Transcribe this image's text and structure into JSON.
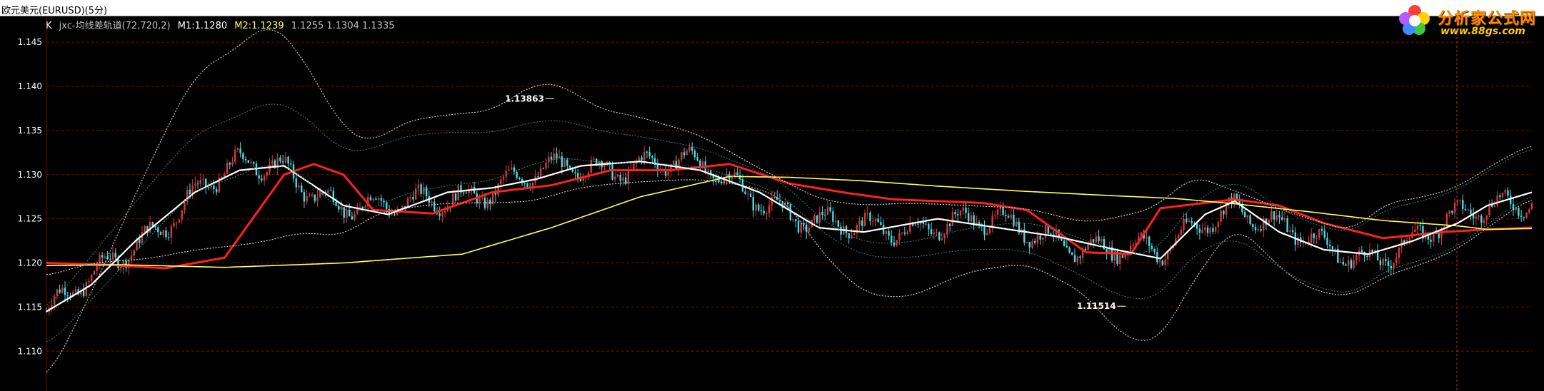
{
  "window": {
    "title": "欧元美元(EURUSD)(5分)"
  },
  "legend": {
    "k": "K",
    "indicator": "jxc-均线差轨道(72,720,2)",
    "m1": "M1:1.1280",
    "m2": "M2:1.1239",
    "extra": "1.1255 1.1304 1.1335"
  },
  "watermark": {
    "brand": "分析家公式网",
    "url": "www.88gs.com"
  },
  "colors": {
    "background": "#000000",
    "grid": "#8b0000",
    "up_candle": "#d23c3c",
    "down_candle": "#40e0e8",
    "m1": "#ffffff",
    "m2": "#ffff5a",
    "red_ma": "#ff2020",
    "band_outer": "#c8c8c8",
    "band_inner": "#2e8b7a"
  },
  "chart_data": {
    "type": "line",
    "title": "欧元美元(EURUSD)(5分)",
    "ylim": [
      1.1055,
      1.148
    ],
    "yticks": [
      "1.145",
      "1.140",
      "1.135",
      "1.130",
      "1.125",
      "1.120",
      "1.115",
      "1.110"
    ],
    "grid": "horizontal dashed",
    "annotations": [
      {
        "text": "1.13863",
        "x": 0.335,
        "y": 1.1386
      },
      {
        "text": "1.11514",
        "x": 0.72,
        "y": 1.1151
      }
    ],
    "series": [
      {
        "name": "M1",
        "color": "#ffffff",
        "x": [
          0,
          0.03,
          0.06,
          0.1,
          0.13,
          0.16,
          0.2,
          0.23,
          0.27,
          0.3,
          0.33,
          0.36,
          0.4,
          0.44,
          0.48,
          0.52,
          0.55,
          0.6,
          0.64,
          0.68,
          0.72,
          0.75,
          0.78,
          0.8,
          0.83,
          0.86,
          0.89,
          0.92,
          0.95,
          0.97,
          1.0
        ],
        "values": [
          1.1145,
          1.1175,
          1.1225,
          1.128,
          1.1305,
          1.131,
          1.1265,
          1.1255,
          1.128,
          1.1285,
          1.1295,
          1.131,
          1.1315,
          1.1305,
          1.128,
          1.124,
          1.1235,
          1.125,
          1.124,
          1.123,
          1.1215,
          1.1205,
          1.1255,
          1.127,
          1.1235,
          1.1215,
          1.121,
          1.1225,
          1.1245,
          1.1265,
          1.128
        ]
      },
      {
        "name": "M2",
        "color": "#ffff5a",
        "x": [
          0,
          0.05,
          0.12,
          0.2,
          0.28,
          0.34,
          0.4,
          0.46,
          0.5,
          0.55,
          0.6,
          0.66,
          0.72,
          0.76,
          0.8,
          0.85,
          0.9,
          0.95,
          0.97,
          1.0
        ],
        "values": [
          1.1197,
          1.1198,
          1.1195,
          1.12,
          1.121,
          1.124,
          1.1275,
          1.1298,
          1.1297,
          1.1293,
          1.1287,
          1.1281,
          1.1276,
          1.1273,
          1.1267,
          1.1258,
          1.1248,
          1.1242,
          1.1238,
          1.1239
        ]
      },
      {
        "name": "",
        "color": "#ff2020",
        "x": [
          0,
          0.04,
          0.08,
          0.12,
          0.16,
          0.18,
          0.2,
          0.22,
          0.26,
          0.3,
          0.34,
          0.38,
          0.42,
          0.46,
          0.5,
          0.54,
          0.57,
          0.6,
          0.63,
          0.66,
          0.7,
          0.73,
          0.75,
          0.8,
          0.83,
          0.86,
          0.9,
          0.94,
          0.97,
          1.0
        ],
        "values": [
          1.12,
          1.1198,
          1.1194,
          1.1206,
          1.13,
          1.1312,
          1.13,
          1.126,
          1.1256,
          1.128,
          1.1288,
          1.1305,
          1.1305,
          1.1312,
          1.129,
          1.1279,
          1.1272,
          1.127,
          1.1268,
          1.126,
          1.1212,
          1.121,
          1.1262,
          1.1272,
          1.1265,
          1.1245,
          1.1228,
          1.1235,
          1.1238,
          1.124
        ]
      },
      {
        "name": "",
        "color": "#c8c8c8",
        "x": [
          0,
          0.03,
          0.07,
          0.1,
          0.13,
          0.15,
          0.17,
          0.2,
          0.22,
          0.24,
          0.27,
          0.3,
          0.33,
          0.35,
          0.37,
          0.4,
          0.44,
          0.48,
          0.5,
          0.52,
          0.55,
          0.58,
          0.62,
          0.66,
          0.7,
          0.73,
          0.75,
          0.77,
          0.8,
          0.84,
          0.88,
          0.9,
          0.92,
          0.95,
          0.97,
          1.0
        ],
        "values": [
          1.1065,
          1.1165,
          1.1315,
          1.1415,
          1.1445,
          1.1475,
          1.144,
          1.135,
          1.1335,
          1.136,
          1.1368,
          1.1372,
          1.1405,
          1.14,
          1.1375,
          1.1365,
          1.1345,
          1.1307,
          1.129,
          1.1272,
          1.1265,
          1.1268,
          1.1265,
          1.1262,
          1.1245,
          1.1255,
          1.1265,
          1.13,
          1.1282,
          1.1255,
          1.1235,
          1.1268,
          1.1272,
          1.1285,
          1.1308,
          1.1335
        ]
      },
      {
        "name": "",
        "color": "#c8c8c8",
        "x": [
          0,
          0.03,
          0.07,
          0.1,
          0.13,
          0.15,
          0.17,
          0.2,
          0.22,
          0.24,
          0.27,
          0.3,
          0.33,
          0.35,
          0.37,
          0.4,
          0.44,
          0.48,
          0.5,
          0.52,
          0.55,
          0.58,
          0.62,
          0.66,
          0.7,
          0.72,
          0.74,
          0.75,
          0.77,
          0.8,
          0.84,
          0.86,
          0.88,
          0.9,
          0.92,
          0.95,
          0.97,
          1.0
        ],
        "values": [
          1.1185,
          1.12,
          1.1205,
          1.1215,
          1.122,
          1.1225,
          1.1235,
          1.123,
          1.1255,
          1.1262,
          1.1268,
          1.1268,
          1.127,
          1.1282,
          1.1288,
          1.1292,
          1.1295,
          1.1285,
          1.1268,
          1.1215,
          1.1165,
          1.116,
          1.119,
          1.12,
          1.1165,
          1.1122,
          1.1108,
          1.1112,
          1.1175,
          1.1245,
          1.118,
          1.1165,
          1.1162,
          1.1185,
          1.1195,
          1.1215,
          1.124,
          1.1275
        ]
      }
    ]
  }
}
